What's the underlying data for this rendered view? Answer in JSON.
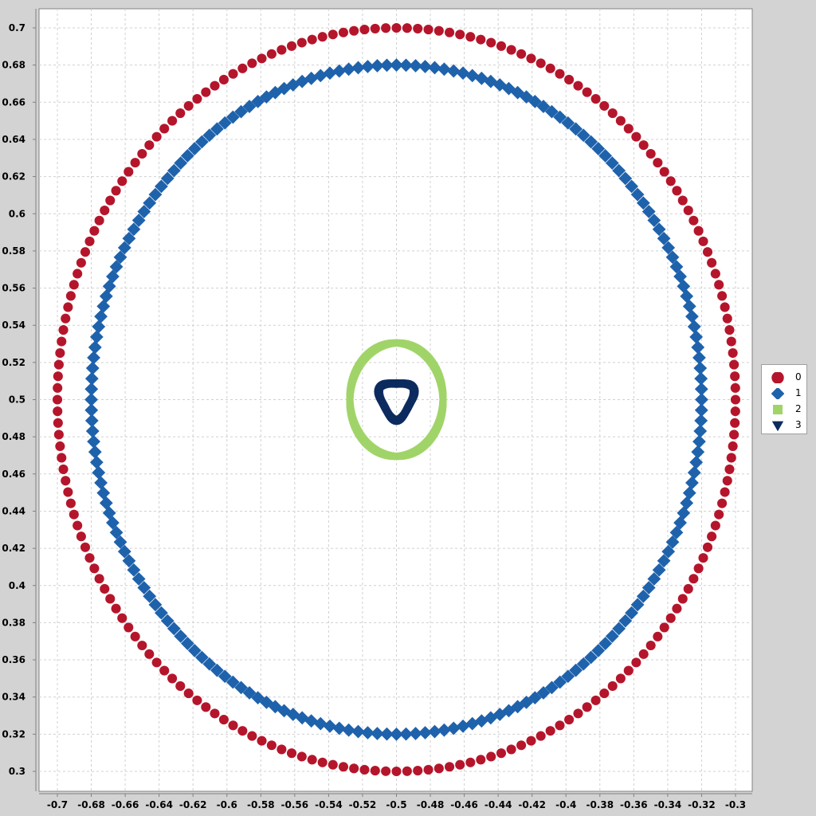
{
  "chart_data": {
    "type": "scatter",
    "xlim": [
      -0.7,
      -0.3
    ],
    "ylim": [
      0.3,
      0.7
    ],
    "x_ticks": [
      "-0.7",
      "-0.68",
      "-0.66",
      "-0.64",
      "-0.62",
      "-0.6",
      "-0.58",
      "-0.56",
      "-0.54",
      "-0.52",
      "-0.5",
      "-0.48",
      "-0.46",
      "-0.44",
      "-0.42",
      "-0.4",
      "-0.38",
      "-0.36",
      "-0.34",
      "-0.32",
      "-0.3"
    ],
    "y_ticks": [
      "0.7",
      "0.68",
      "0.66",
      "0.64",
      "0.62",
      "0.6",
      "0.58",
      "0.56",
      "0.54",
      "0.52",
      "0.5",
      "0.48",
      "0.46",
      "0.44",
      "0.42",
      "0.4",
      "0.38",
      "0.36",
      "0.34",
      "0.32",
      "0.3"
    ],
    "grid": true,
    "legend_position": "right",
    "series": [
      {
        "name": "0",
        "marker": "circle",
        "color": "#b5152b",
        "shape": "circle",
        "center": [
          -0.5,
          0.5
        ],
        "radius": 0.2,
        "points": 200
      },
      {
        "name": "1",
        "marker": "diamond",
        "color": "#1f62ac",
        "shape": "circle",
        "center": [
          -0.5,
          0.5
        ],
        "radius": 0.18,
        "points": 200
      },
      {
        "name": "2",
        "marker": "square",
        "color": "#a0d468",
        "shape": "ellipse",
        "center": [
          -0.5,
          0.5
        ],
        "radius_x": 0.0275,
        "radius_y": 0.0305,
        "points": 300
      },
      {
        "name": "3",
        "marker": "triangle-down",
        "color": "#0c2b5e",
        "shape": "rounded-triangle",
        "center": [
          -0.5,
          0.5
        ],
        "radius": 0.01,
        "points": 200
      }
    ]
  }
}
